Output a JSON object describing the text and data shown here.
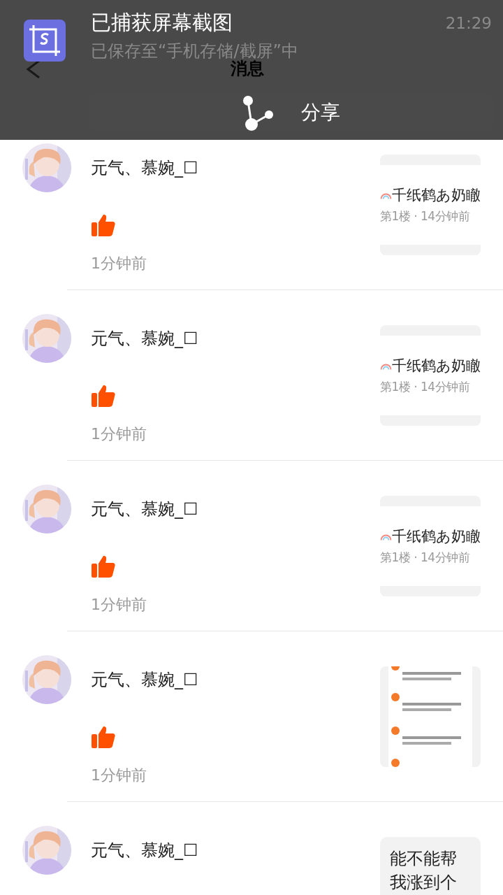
{
  "notification": {
    "title": "已捕获屏幕截图",
    "subtitle": "已保存至“手机存储/截屏”中",
    "time": "21:29",
    "action": "分享"
  },
  "header": {
    "title": "消息"
  },
  "items": [
    {
      "user": "元气、慕婉_☐",
      "time": "1分钟前",
      "preview": {
        "kind": "post",
        "title": "千纸鹤あ奶瞮",
        "meta": "第1楼 · 14分钟前"
      }
    },
    {
      "user": "元气、慕婉_☐",
      "time": "1分钟前",
      "preview": {
        "kind": "post",
        "title": "千纸鹤あ奶瞮",
        "meta": "第1楼 · 14分钟前"
      }
    },
    {
      "user": "元气、慕婉_☐",
      "time": "1分钟前",
      "preview": {
        "kind": "post",
        "title": "千纸鹤あ奶瞮",
        "meta": "第1楼 · 14分钟前"
      }
    },
    {
      "user": "元气、慕婉_☐",
      "time": "1分钟前"
    },
    {
      "user": "元气、慕婉_☐",
      "preview": {
        "kind": "text",
        "text": "能不能帮我涨到个"
      }
    }
  ]
}
